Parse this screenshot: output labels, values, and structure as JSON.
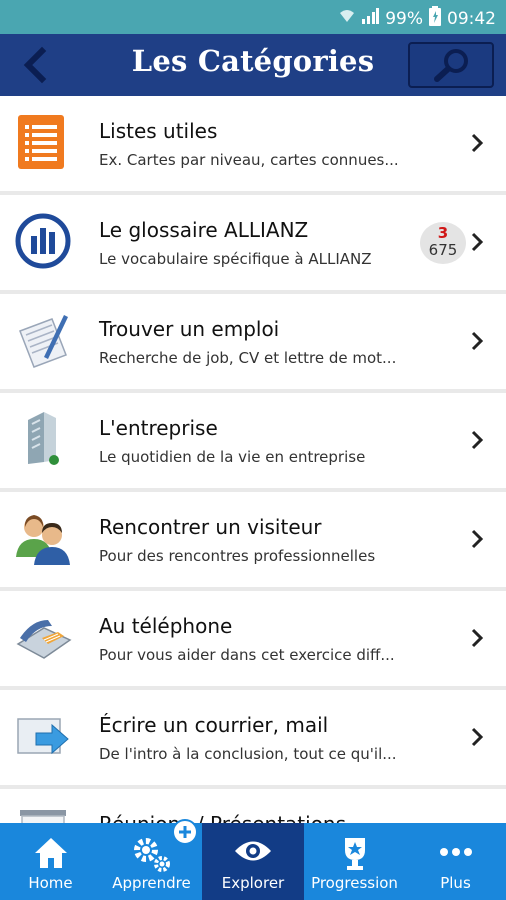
{
  "status_bar": {
    "battery": "99%",
    "time": "09:42"
  },
  "header": {
    "title": "Les Catégories"
  },
  "categories": [
    {
      "title": "Listes utiles",
      "subtitle": "Ex. Cartes par niveau, cartes connues..."
    },
    {
      "title": "Le glossaire ALLIANZ",
      "subtitle": "Le vocabulaire spécifique à ALLIANZ",
      "badge_new": "3",
      "badge_total": "675"
    },
    {
      "title": "Trouver un emploi",
      "subtitle": "Recherche de job, CV et lettre de mot..."
    },
    {
      "title": "L'entreprise",
      "subtitle": "Le quotidien de la vie en entreprise"
    },
    {
      "title": "Rencontrer un visiteur",
      "subtitle": "Pour des rencontres professionnelles"
    },
    {
      "title": "Au téléphone",
      "subtitle": "Pour vous aider dans cet exercice diff..."
    },
    {
      "title": "Écrire un courrier, mail",
      "subtitle": "De l'intro à la conclusion, tout ce qu'il..."
    },
    {
      "title": "Réunions / Présentations",
      "subtitle": ""
    }
  ],
  "nav": [
    {
      "label": "Home"
    },
    {
      "label": "Apprendre"
    },
    {
      "label": "Explorer"
    },
    {
      "label": "Progression"
    },
    {
      "label": "Plus"
    }
  ],
  "colors": {
    "status_bar": "#4aa6b1",
    "header": "#1f3f86",
    "nav": "#1a87dc",
    "nav_active": "#123c86",
    "badge_red": "#d01717"
  }
}
